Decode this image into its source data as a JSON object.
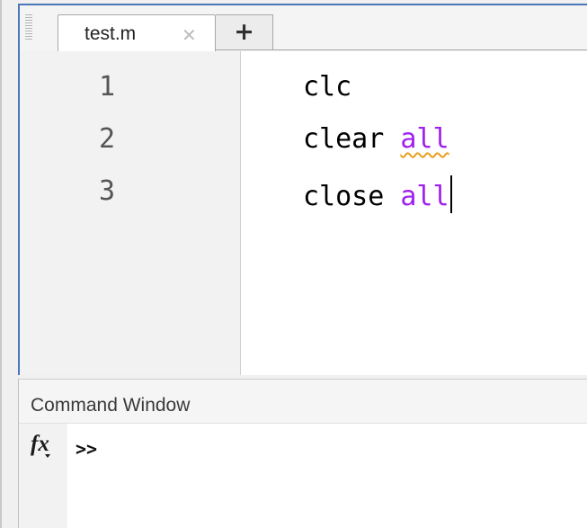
{
  "editor": {
    "tabs": [
      {
        "label": "test.m",
        "close_glyph": "✕",
        "close_icon": "close-icon",
        "active": true
      }
    ],
    "add_tab_label": "+",
    "lines": [
      {
        "number": "1",
        "code": "clc",
        "keyword": "",
        "keyword_color": ""
      },
      {
        "number": "2",
        "code": "clear ",
        "keyword": "all",
        "keyword_color": "#a020f0",
        "squiggle": true
      },
      {
        "number": "3",
        "code": "close ",
        "keyword": "all",
        "keyword_color": "#a020f0",
        "caret": true
      }
    ],
    "border_color": "#4a78b8"
  },
  "command_window": {
    "title": "Command Window",
    "fx_icon": "fx-function-browser-icon",
    "fx_label": "fx",
    "prompt": ">>"
  }
}
